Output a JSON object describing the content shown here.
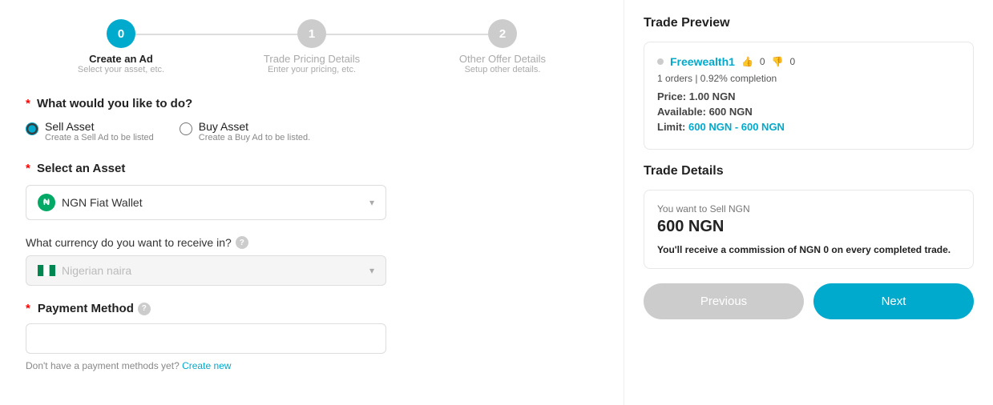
{
  "stepper": {
    "steps": [
      {
        "number": "0",
        "title": "Create an Ad",
        "subtitle": "Select your asset, etc.",
        "state": "active"
      },
      {
        "number": "1",
        "title": "Trade Pricing Details",
        "subtitle": "Enter your pricing, etc.",
        "state": "inactive"
      },
      {
        "number": "2",
        "title": "Other Offer Details",
        "subtitle": "Setup other details.",
        "state": "inactive"
      }
    ]
  },
  "what_to_do": {
    "label": "What would you like to do?",
    "options": [
      {
        "id": "sell",
        "title": "Sell Asset",
        "subtitle": "Create a Sell Ad to be listed",
        "checked": true
      },
      {
        "id": "buy",
        "title": "Buy Asset",
        "subtitle": "Create a Buy Ad to be listed.",
        "checked": false
      }
    ]
  },
  "asset": {
    "label": "Select an Asset",
    "selected": "NGN Fiat Wallet"
  },
  "currency": {
    "label": "What currency do you want to receive in?",
    "selected": "Nigerian naira"
  },
  "payment_method": {
    "label": "Payment Method",
    "placeholder": "",
    "no_methods_text": "Don't have a payment methods yet?",
    "create_new_label": "Create new",
    "create_new_href": "#"
  },
  "trade_preview": {
    "title": "Trade Preview",
    "user": {
      "username": "Freewealth1",
      "thumbs_up": "0",
      "thumbs_down": "0"
    },
    "orders": "1 orders | 0.92% completion",
    "price_label": "Price:",
    "price_value": "1.00 NGN",
    "available_label": "Available:",
    "available_value": "600 NGN",
    "limit_label": "Limit:",
    "limit_value": "600 NGN - 600 NGN"
  },
  "trade_details": {
    "title": "Trade Details",
    "sell_label": "You want to Sell NGN",
    "amount": "600 NGN",
    "commission_text": "You'll receive a commission of",
    "commission_bold": "NGN 0",
    "commission_suffix": "on every completed trade."
  },
  "buttons": {
    "previous": "Previous",
    "next": "Next"
  }
}
